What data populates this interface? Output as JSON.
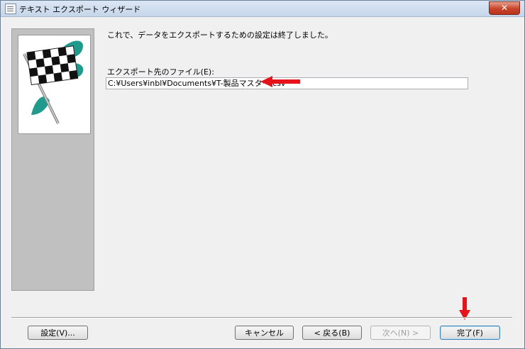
{
  "window": {
    "title": "テキスト エクスポート ウィザード",
    "close_label": "✕"
  },
  "content": {
    "message": "これで、データをエクスポートするための設定は終了しました。",
    "field_label": "エクスポート先のファイル(E):",
    "file_path": "C:¥Users¥inbl¥Documents¥T-製品マスター.csv"
  },
  "buttons": {
    "settings": "設定(V)...",
    "cancel": "キャンセル",
    "back": "< 戻る(B)",
    "next": "次へ(N) >",
    "finish": "完了(F)"
  },
  "colors": {
    "annotation_arrow": "#e8131a",
    "panel_gray": "#c0c0c0",
    "flag_teal": "#1f9a8c"
  },
  "icons": {
    "flag": "checkered-flag-icon",
    "arrow_left": "red-arrow-left-icon",
    "arrow_down": "red-arrow-down-icon"
  }
}
